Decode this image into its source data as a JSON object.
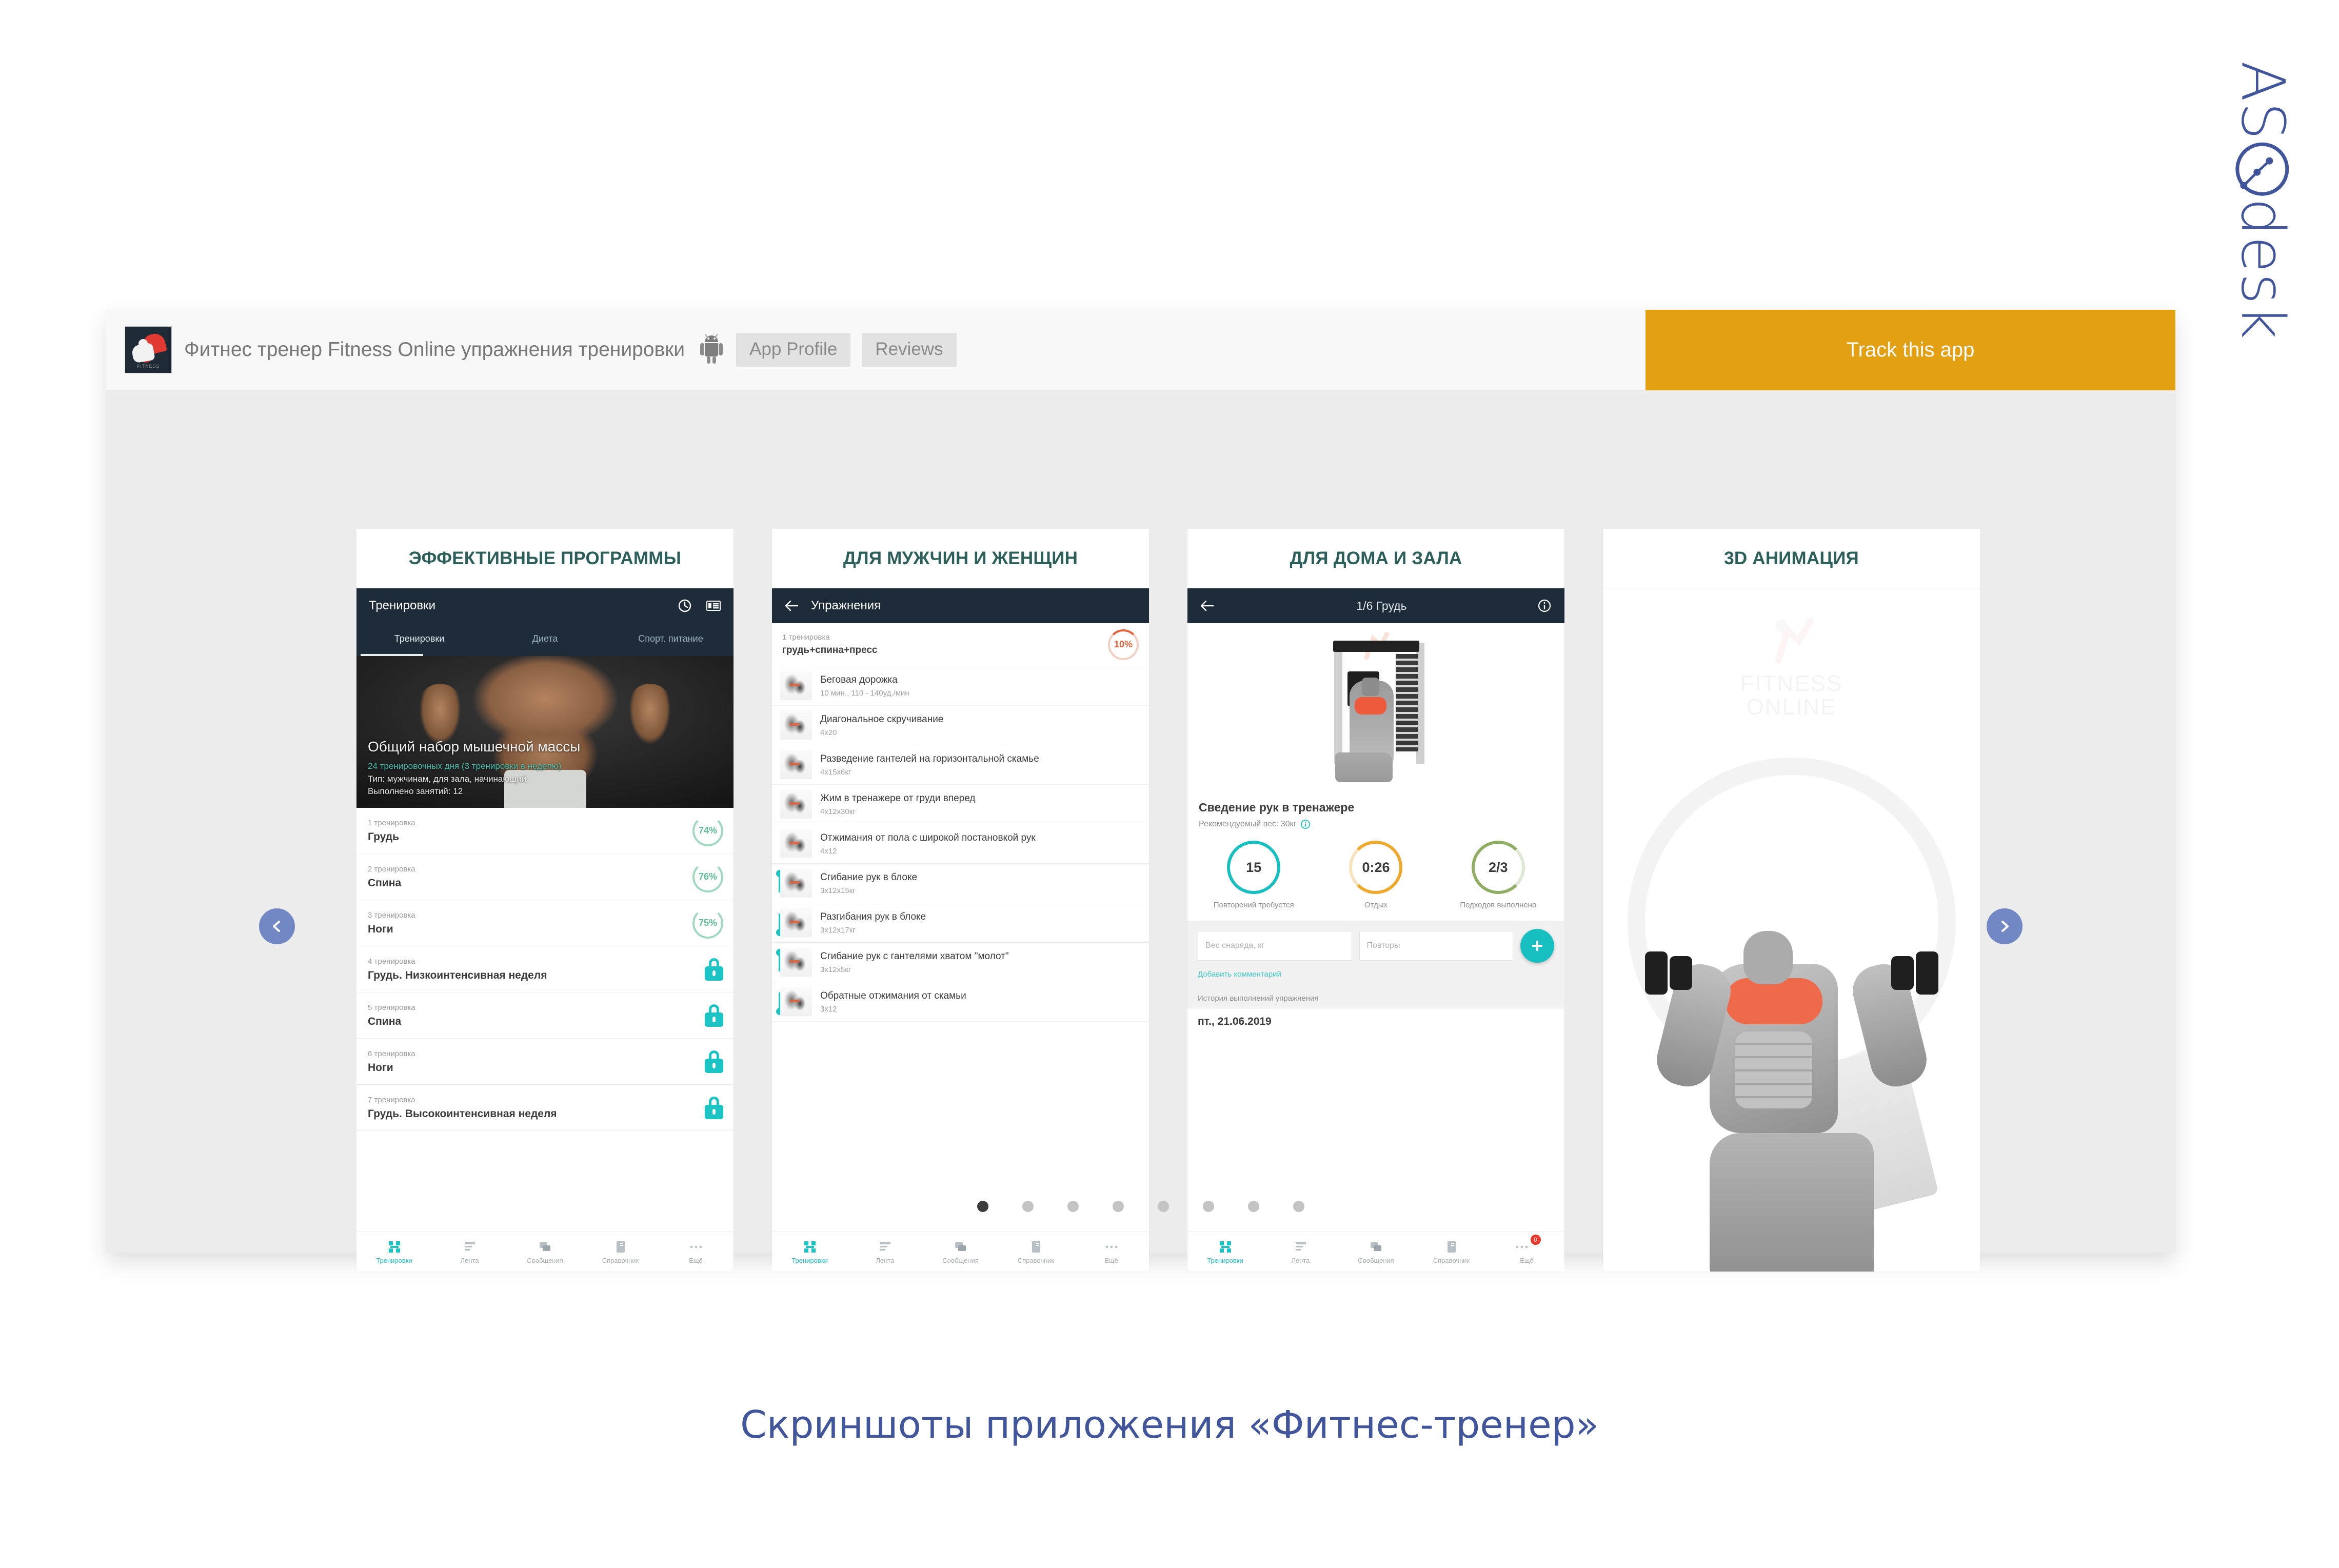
{
  "brand": {
    "name": "ASOdesk"
  },
  "header": {
    "app_title": "Фитнес тренер Fitness Online упражнения тренировки",
    "platform_icon": "android-icon",
    "buttons": [
      {
        "label": "App Profile"
      },
      {
        "label": "Reviews"
      }
    ],
    "track_button": {
      "label": "Track this app",
      "color": "#e3a012"
    }
  },
  "carousel": {
    "prev_icon": "chevron-left-icon",
    "next_icon": "chevron-right-icon",
    "dots_total": 8,
    "active_dot": 1
  },
  "panels": [
    {
      "title": "ЭФФЕКТИВНЫЕ ПРОГРАММЫ",
      "appbar": {
        "title": "Тренировки",
        "icons": [
          "clock-icon",
          "list-icon"
        ]
      },
      "tabs": [
        {
          "label": "Тренировки",
          "active": true
        },
        {
          "label": "Диета",
          "active": false
        },
        {
          "label": "Спорт. питание",
          "active": false
        }
      ],
      "hero": {
        "title": "Общий набор мышечной массы",
        "line1": "24 тренировочных дня (3 тренировки в неделю)",
        "line2": "Тип: мужчинам, для зала, начинающий",
        "line3": "Выполнено занятий: 12"
      },
      "workouts": [
        {
          "index": "1 тренировка",
          "name": "Грудь",
          "progress": "74%",
          "locked": false
        },
        {
          "index": "2 тренировка",
          "name": "Спина",
          "progress": "76%",
          "locked": false
        },
        {
          "index": "3 тренировка",
          "name": "Ноги",
          "progress": "75%",
          "locked": false
        },
        {
          "index": "4 тренировка",
          "name": "Грудь. Низкоинтенсивная неделя",
          "progress": "",
          "locked": true
        },
        {
          "index": "5 тренировка",
          "name": "Спина",
          "progress": "",
          "locked": true
        },
        {
          "index": "6 тренировка",
          "name": "Ноги",
          "progress": "",
          "locked": true
        },
        {
          "index": "7 тренировка",
          "name": "Грудь. Высокоинтенсивная неделя",
          "progress": "",
          "locked": true
        }
      ]
    },
    {
      "title": "ДЛЯ МУЖЧИН И ЖЕНЩИН",
      "appbar": {
        "title": "Упражнения",
        "back_icon": "arrow-left-icon"
      },
      "session": {
        "index": "1 тренировка",
        "name": "грудь+спина+пресс",
        "progress": "10%"
      },
      "exercises": [
        {
          "name": "Беговая дорожка",
          "sets": "10 мин., 110 - 140уд./мин",
          "superset": ""
        },
        {
          "name": "Диагональное скручивание",
          "sets": "4x20",
          "superset": ""
        },
        {
          "name": "Разведение гантелей на горизонтальной скамье",
          "sets": "4x15x6кг",
          "superset": ""
        },
        {
          "name": "Жим в тренажере от груди вперед",
          "sets": "4x12x30кг",
          "superset": ""
        },
        {
          "name": "Отжимания от пола с широкой постановкой рук",
          "sets": "4x12",
          "superset": ""
        },
        {
          "name": "Сгибание рук в блоке",
          "sets": "3x12x15кг",
          "superset": "start"
        },
        {
          "name": "Разгибания рук в блоке",
          "sets": "3x12x17кг",
          "superset": "end"
        },
        {
          "name": "Сгибание рук с гантелями хватом \"молот\"",
          "sets": "3x12x5кг",
          "superset": "start"
        },
        {
          "name": "Обратные отжимания от скамьи",
          "sets": "3x12",
          "superset": "end"
        }
      ]
    },
    {
      "title": "ДЛЯ ДОМА И ЗАЛА",
      "appbar": {
        "title": "1/6 Грудь",
        "back_icon": "arrow-left-icon",
        "info_icon": "info-circle-icon"
      },
      "exercise": {
        "name": "Сведение рук в тренажере",
        "recommended": "Рекомендуемый вес: 30кг",
        "info_icon": "info-circle-icon"
      },
      "stats": [
        {
          "value": "15",
          "caption": "Повторений\nтребуется",
          "color": "#17bfc0"
        },
        {
          "value": "0:26",
          "caption": "Отдых",
          "color": "#f0a82c"
        },
        {
          "value": "2/3",
          "caption": "Подходов\nвыполнено",
          "color": "#8fae63"
        }
      ],
      "inputs": [
        {
          "placeholder": "Вес снаряда, кг",
          "value": ""
        },
        {
          "placeholder": "Повторы",
          "value": ""
        }
      ],
      "add_button_icon": "plus-icon",
      "add_comment": "Добавить комментарий",
      "history_label": "История выполнений упражнения",
      "history_date": "пт., 21.06.2019"
    },
    {
      "title": "3D АНИМАЦИЯ",
      "watermark_line1": "FITNESS",
      "watermark_line2": "ONLINE"
    }
  ],
  "bottom_nav": [
    {
      "label": "Тренировки",
      "icon": "grid-icon",
      "active": true
    },
    {
      "label": "Лента",
      "icon": "feed-icon",
      "active": false
    },
    {
      "label": "Сообщения",
      "icon": "messages-icon",
      "active": false
    },
    {
      "label": "Справочник",
      "icon": "book-icon",
      "active": false
    },
    {
      "label": "Ещё",
      "icon": "more-icon",
      "active": false,
      "badge": "0"
    }
  ],
  "caption": "Скриншоты приложения «Фитнес-тренер»"
}
